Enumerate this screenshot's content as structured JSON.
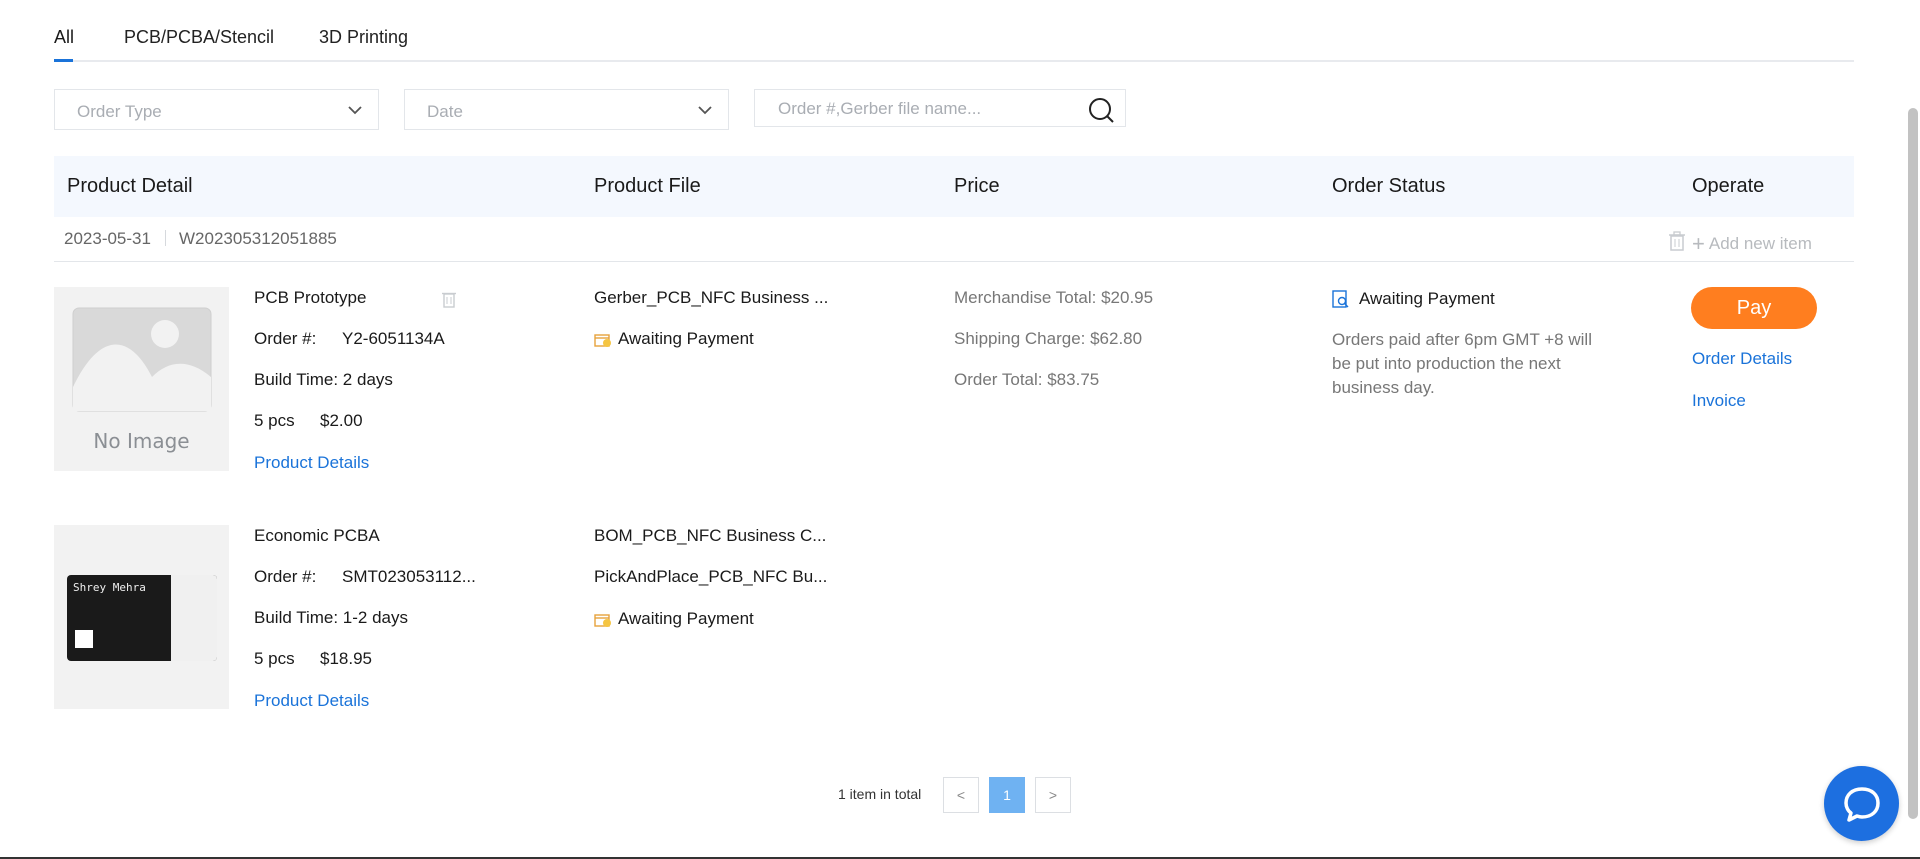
{
  "tabs": [
    "All",
    "PCB/PCBA/Stencil",
    "3D Printing"
  ],
  "filters": {
    "order_type_placeholder": "Order Type",
    "date_placeholder": "Date",
    "search_placeholder": "Order #,Gerber file name..."
  },
  "table_headers": {
    "product_detail": "Product Detail",
    "product_file": "Product File",
    "price": "Price",
    "order_status": "Order Status",
    "operate": "Operate"
  },
  "group": {
    "date": "2023-05-31",
    "order_number": "W202305312051885",
    "add_new_item": "Add new item"
  },
  "items": [
    {
      "product": "PCB Prototype",
      "order_label": "Order #:",
      "order_number": "Y2-6051134A",
      "build_time": "Build Time: 2 days",
      "qty": "5 pcs",
      "price": "$2.00",
      "details_link": "Product Details",
      "image_text": "No Image",
      "files": [
        "Gerber_PCB_NFC Business ..."
      ],
      "file_status": "Awaiting Payment"
    },
    {
      "product": "Economic PCBA",
      "order_label": "Order #:",
      "order_number": "SMT023053112...",
      "build_time": "Build Time: 1-2 days",
      "qty": "5 pcs",
      "price": "$18.95",
      "details_link": "Product Details",
      "image_card_name": "Shrey Mehra",
      "files": [
        "BOM_PCB_NFC Business C...",
        "PickAndPlace_PCB_NFC Bu..."
      ],
      "file_status": "Awaiting Payment"
    }
  ],
  "price": {
    "merchandise_total": "Merchandise Total: $20.95",
    "shipping_charge": "Shipping Charge: $62.80",
    "order_total": "Order Total: $83.75"
  },
  "order_status": {
    "label": "Awaiting Payment",
    "note": "Orders paid after 6pm GMT +8 will be put into production the next business day."
  },
  "operate": {
    "pay": "Pay",
    "order_details": "Order Details",
    "invoice": "Invoice"
  },
  "pagination": {
    "total": "1 item in total",
    "prev": "<",
    "current": "1",
    "next": ">"
  },
  "colors": {
    "accent": "#1a73d9",
    "pay": "#ff7e1f",
    "chat": "#1d6fe0"
  }
}
